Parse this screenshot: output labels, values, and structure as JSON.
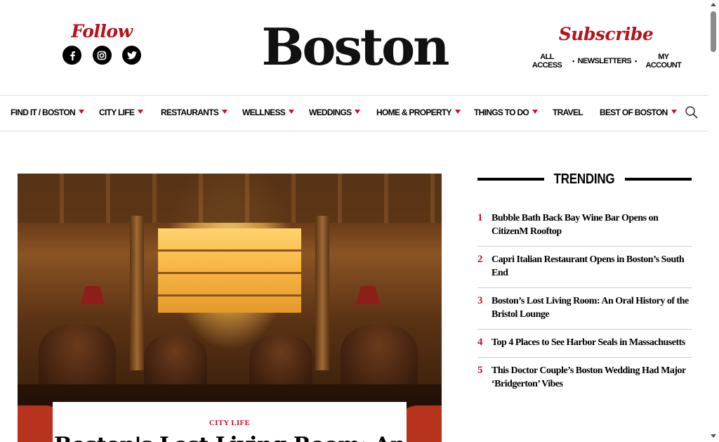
{
  "header": {
    "follow_label": "Follow",
    "social_icons": [
      "facebook-icon",
      "instagram-icon",
      "twitter-icon"
    ],
    "logo": "Boston",
    "subscribe_label": "Subscribe",
    "subscribe_links": [
      "ALL ACCESS",
      "NEWSLETTERS",
      "MY ACCOUNT"
    ],
    "link_separator": "•"
  },
  "nav": {
    "items": [
      {
        "label": "FIND IT / BOSTON",
        "has_menu": true
      },
      {
        "label": "CITY LIFE",
        "has_menu": true
      },
      {
        "label": "RESTAURANTS",
        "has_menu": true
      },
      {
        "label": "WELLNESS",
        "has_menu": true
      },
      {
        "label": "WEDDINGS",
        "has_menu": true
      },
      {
        "label": "HOME & PROPERTY",
        "has_menu": true
      },
      {
        "label": "THINGS TO DO",
        "has_menu": true
      },
      {
        "label": "TRAVEL",
        "has_menu": false
      },
      {
        "label": "BEST OF BOSTON",
        "has_menu": true
      }
    ],
    "search_icon": "search-icon"
  },
  "hero": {
    "category": "CITY LIFE",
    "title": "Boston's Lost Living Room: An"
  },
  "trending": {
    "heading": "TRENDING",
    "items": [
      {
        "rank": "1",
        "title": "Bubble Bath Back Bay Wine Bar Opens on CitizenM Rooftop"
      },
      {
        "rank": "2",
        "title": "Capri Italian Restaurant Opens in Boston’s South End"
      },
      {
        "rank": "3",
        "title": "Boston’s Lost Living Room: An Oral History of the Bristol Lounge"
      },
      {
        "rank": "4",
        "title": "Top 4 Places to See Harbor Seals in Massachusetts"
      },
      {
        "rank": "5",
        "title": "This Doctor Couple’s Boston Wedding Had Major ‘Bridgerton’ Vibes"
      }
    ]
  },
  "colors": {
    "accent_red": "#c8102e",
    "script_red": "#b5121b",
    "text": "#000000"
  }
}
